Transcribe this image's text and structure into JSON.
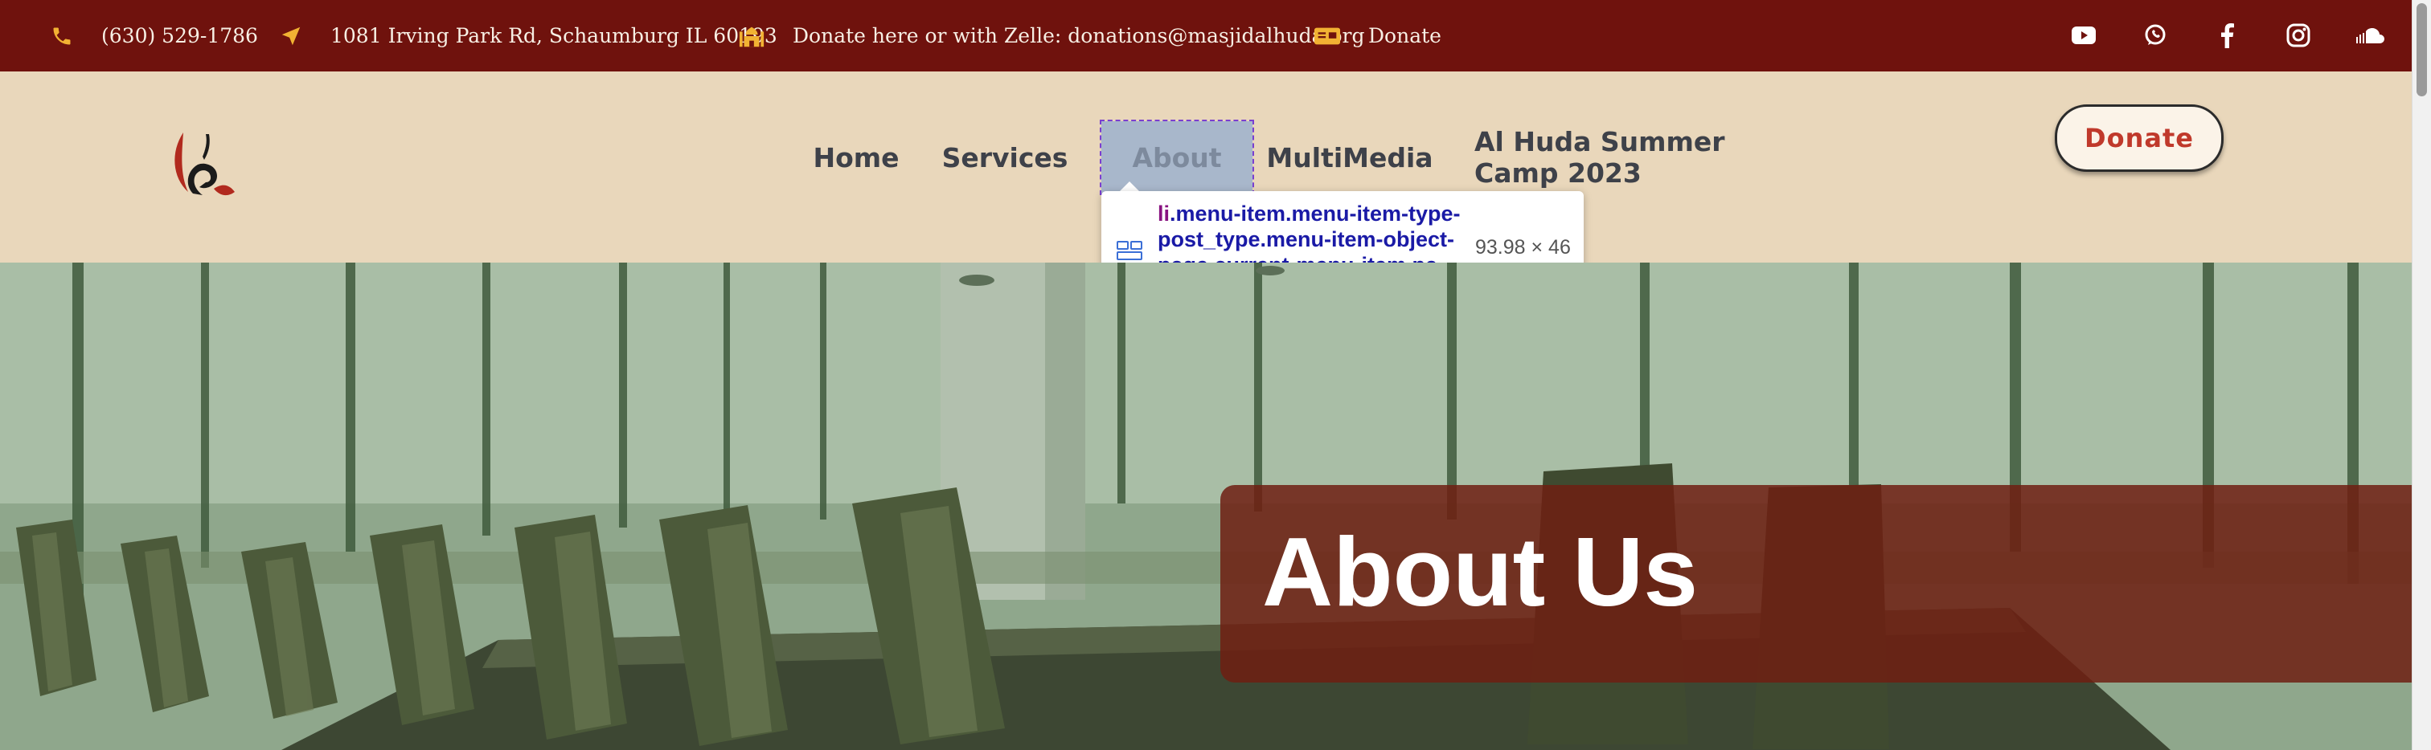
{
  "topbar": {
    "phone": "(630) 529-1786",
    "address": "1081 Irving Park Rd, Schaumburg IL 60193",
    "donate_text": "Donate here or with Zelle: donations@masjidalhuda.org",
    "donate_link": "Donate",
    "icon_color": "#f2b233",
    "social_icons": [
      "youtube-icon",
      "whatsapp-icon",
      "facebook-icon",
      "instagram-icon",
      "soundcloud-icon"
    ]
  },
  "header": {
    "nav": [
      "Home",
      "Services",
      "About",
      "MultiMedia",
      "Al Huda Summer Camp 2023"
    ],
    "active_nav": "About",
    "donate_button": "Donate"
  },
  "devtools_tooltip": {
    "tag": "li",
    "selector": ".menu-item.menu-item-type-post_type.menu-item-object-page.current-menu-item.pa g...",
    "size": "93.98 × 46"
  },
  "hero": {
    "title": "About Us"
  },
  "colors": {
    "topbar_bg": "#6f120d",
    "header_bg": "#e9d7bb",
    "accent": "#c0392b",
    "hero_overlay": "#8aa585"
  }
}
